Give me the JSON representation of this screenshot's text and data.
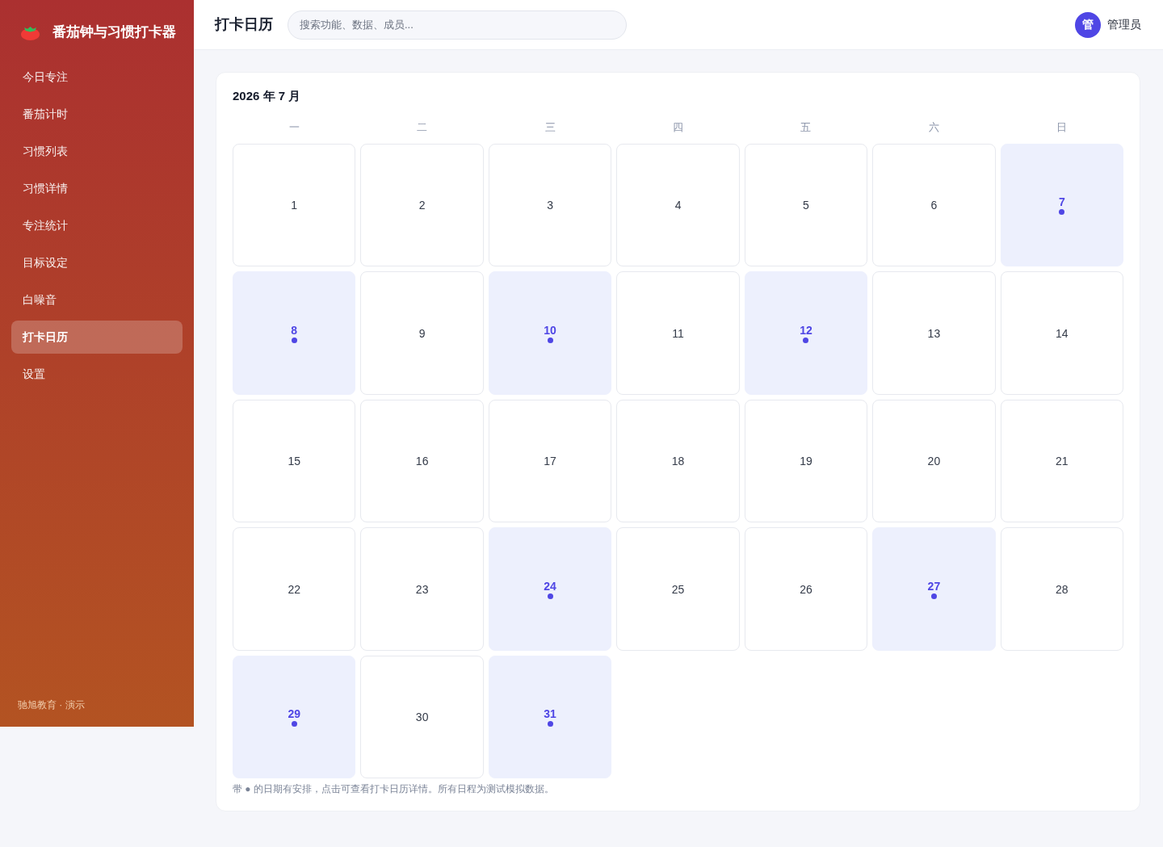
{
  "sidebar": {
    "brand": "番茄钟与习惯打卡器",
    "items": [
      {
        "label": "今日专注",
        "selected": false
      },
      {
        "label": "番茄计时",
        "selected": false
      },
      {
        "label": "习惯列表",
        "selected": false
      },
      {
        "label": "习惯详情",
        "selected": false
      },
      {
        "label": "专注统计",
        "selected": false
      },
      {
        "label": "目标设定",
        "selected": false
      },
      {
        "label": "白噪音",
        "selected": false
      },
      {
        "label": "打卡日历",
        "selected": true
      },
      {
        "label": "设置",
        "selected": false
      }
    ],
    "footer": "驰旭教育 · 演示"
  },
  "topbar": {
    "title": "打卡日历",
    "search": {
      "placeholder": "搜索功能、数据、成员..."
    },
    "user": {
      "avatar": "管",
      "name": "管理员"
    }
  },
  "calendar": {
    "title": "2026 年 7 月",
    "weekdays": [
      "一",
      "二",
      "三",
      "四",
      "五",
      "六",
      "日"
    ],
    "days": [
      {
        "label": "1",
        "marked": false
      },
      {
        "label": "2",
        "marked": false
      },
      {
        "label": "3",
        "marked": false
      },
      {
        "label": "4",
        "marked": false
      },
      {
        "label": "5",
        "marked": false
      },
      {
        "label": "6",
        "marked": false
      },
      {
        "label": "7",
        "marked": true
      },
      {
        "label": "8",
        "marked": true
      },
      {
        "label": "9",
        "marked": false
      },
      {
        "label": "10",
        "marked": true
      },
      {
        "label": "11",
        "marked": false
      },
      {
        "label": "12",
        "marked": true
      },
      {
        "label": "13",
        "marked": false
      },
      {
        "label": "14",
        "marked": false
      },
      {
        "label": "15",
        "marked": false
      },
      {
        "label": "16",
        "marked": false
      },
      {
        "label": "17",
        "marked": false
      },
      {
        "label": "18",
        "marked": false
      },
      {
        "label": "19",
        "marked": false
      },
      {
        "label": "20",
        "marked": false
      },
      {
        "label": "21",
        "marked": false
      },
      {
        "label": "22",
        "marked": false
      },
      {
        "label": "23",
        "marked": false
      },
      {
        "label": "24",
        "marked": true
      },
      {
        "label": "25",
        "marked": false
      },
      {
        "label": "26",
        "marked": false
      },
      {
        "label": "27",
        "marked": true
      },
      {
        "label": "28",
        "marked": false
      },
      {
        "label": "29",
        "marked": true
      },
      {
        "label": "30",
        "marked": false
      },
      {
        "label": "31",
        "marked": true
      }
    ],
    "note": "带 ● 的日期有安排，点击可查看打卡日历详情。所有日程为测试模拟数据。"
  }
}
